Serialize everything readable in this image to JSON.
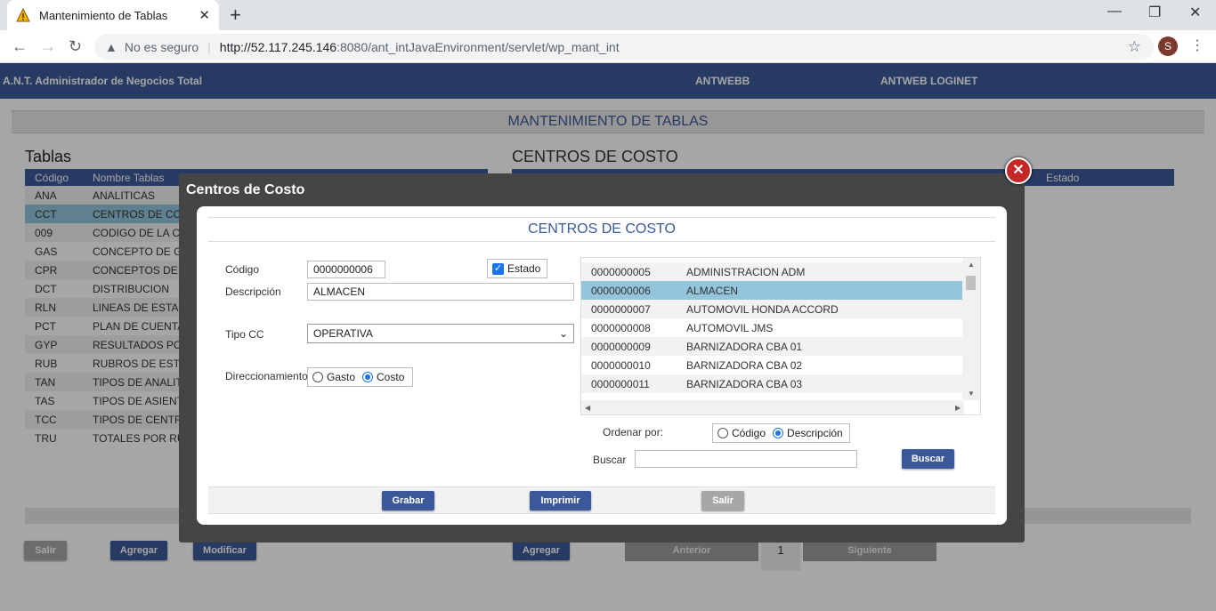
{
  "browser": {
    "tab_title": "Mantenimiento de Tablas",
    "new_tab": "+",
    "security": "No es seguro",
    "url_host": "http://52.117.245.146",
    "url_path": ":8080/ant_intJavaEnvironment/servlet/wp_mant_int",
    "avatar_letter": "S"
  },
  "header": {
    "app_name": "A.N.T. Administrador de Negocios Total",
    "link1": "ANTWEBB",
    "link2": "ANTWEB LOGINET"
  },
  "page": {
    "section_title": "MANTENIMIENTO DE TABLAS",
    "left_heading": "Tablas",
    "right_heading": "CENTROS DE COSTO",
    "table_headers": [
      "Código",
      "Nombre Tablas"
    ],
    "right_header_estado": "Estado",
    "rows": [
      {
        "code": "ANA",
        "name": "ANALITICAS"
      },
      {
        "code": "CCT",
        "name": "CENTROS DE COS"
      },
      {
        "code": "009",
        "name": "CODIGO DE LA CU"
      },
      {
        "code": "GAS",
        "name": "CONCEPTO DE GA"
      },
      {
        "code": "CPR",
        "name": "CONCEPTOS DE P"
      },
      {
        "code": "DCT",
        "name": "DISTRIBUCION"
      },
      {
        "code": "RLN",
        "name": "LINEAS DE ESTAD"
      },
      {
        "code": "PCT",
        "name": "PLAN DE CUENTAS"
      },
      {
        "code": "GYP",
        "name": "RESULTADOS POR"
      },
      {
        "code": "RUB",
        "name": "RUBROS DE ESTA"
      },
      {
        "code": "TAN",
        "name": "TIPOS DE ANALIT"
      },
      {
        "code": "TAS",
        "name": "TIPOS DE ASIENT"
      },
      {
        "code": "TCC",
        "name": "TIPOS DE CENTRO"
      },
      {
        "code": "TRU",
        "name": "TOTALES POR RUB"
      }
    ],
    "buttons": {
      "salir": "Salir",
      "agregar": "Agregar",
      "modificar": "Modificar",
      "agregar2": "Agregar",
      "anterior": "Anterior",
      "page": "1",
      "siguiente": "Siguiente"
    }
  },
  "modal": {
    "title": "Centros de Costo",
    "header": "CENTROS DE COSTO",
    "codigo_label": "Código",
    "codigo_value": "0000000006",
    "estado_label": "Estado",
    "descripcion_label": "Descripción",
    "descripcion_value": "ALMACEN",
    "tipocc_label": "Tipo CC",
    "tipocc_value": "OPERATIVA",
    "direccionamiento_label": "Direccionamiento",
    "gasto_label": "Gasto",
    "costo_label": "Costo",
    "list_items": [
      {
        "code": "0000000005",
        "name": "ADMINISTRACION ADM"
      },
      {
        "code": "0000000006",
        "name": "ALMACEN"
      },
      {
        "code": "0000000007",
        "name": "AUTOMOVIL HONDA ACCORD"
      },
      {
        "code": "0000000008",
        "name": "AUTOMOVIL JMS"
      },
      {
        "code": "0000000009",
        "name": "BARNIZADORA CBA 01"
      },
      {
        "code": "0000000010",
        "name": "BARNIZADORA CBA 02"
      },
      {
        "code": "0000000011",
        "name": "BARNIZADORA CBA 03"
      }
    ],
    "ordenar_label": "Ordenar por:",
    "ord_codigo": "Código",
    "ord_descripcion": "Descripción",
    "buscar_label": "Buscar",
    "buscar_btn": "Buscar",
    "grabar": "Grabar",
    "imprimir": "Imprimir",
    "salir": "Salir"
  }
}
